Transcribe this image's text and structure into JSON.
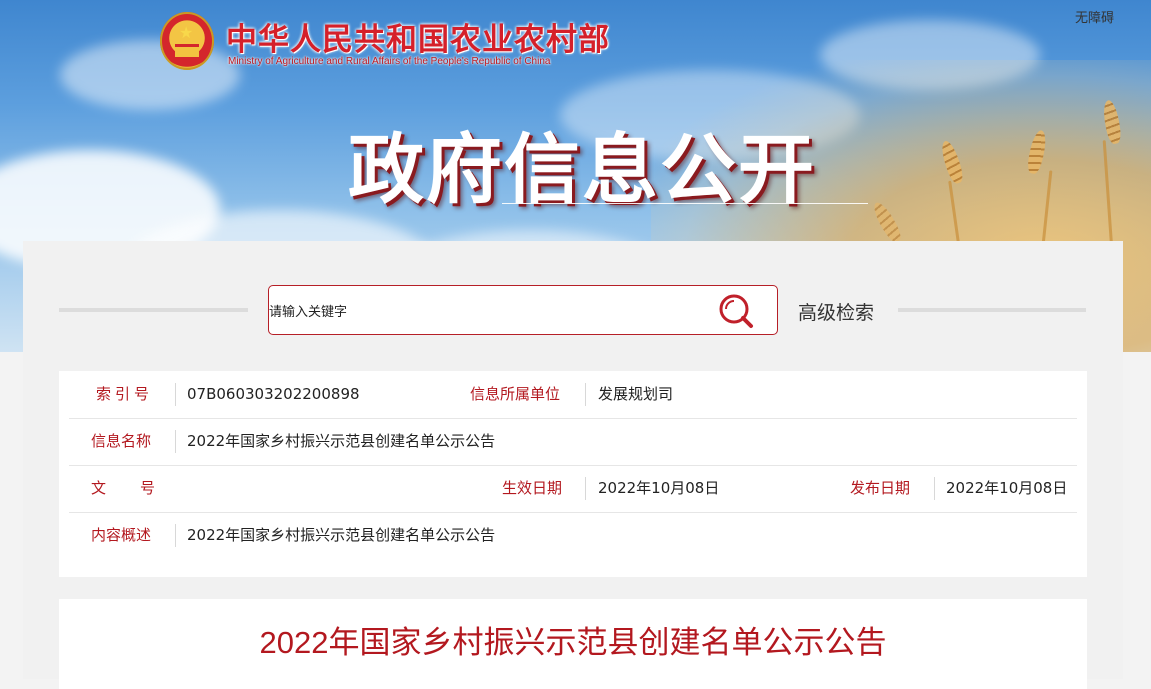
{
  "header": {
    "ministry_cn": "中华人民共和国农业农村部",
    "ministry_en": "Ministry of Agriculture and Rural Affairs of the People's Republic of China",
    "accessibility_link": "无障碍",
    "banner_title": "政府信息公开"
  },
  "search": {
    "placeholder": "请输入关键字",
    "advanced_label": "高级检索",
    "icon": "search-icon"
  },
  "meta": {
    "index_label": "索引号",
    "index_value": "07B060303202200898",
    "dept_label": "信息所属单位",
    "dept_value": "发展规划司",
    "name_label": "信息名称",
    "name_value": "2022年国家乡村振兴示范县创建名单公示公告",
    "doc_no_label": "文号",
    "doc_no_value": "",
    "effective_label": "生效日期",
    "effective_value": "2022年10月08日",
    "publish_label": "发布日期",
    "publish_value": "2022年10月08日",
    "summary_label": "内容概述",
    "summary_value": "2022年国家乡村振兴示范县创建名单公示公告"
  },
  "article": {
    "title": "2022年国家乡村振兴示范县创建名单公示公告"
  },
  "colors": {
    "accent_red": "#b3181f",
    "brand_red": "#d5202a",
    "sky_blue": "#5d9fde",
    "wheat_gold": "#e2b060"
  }
}
